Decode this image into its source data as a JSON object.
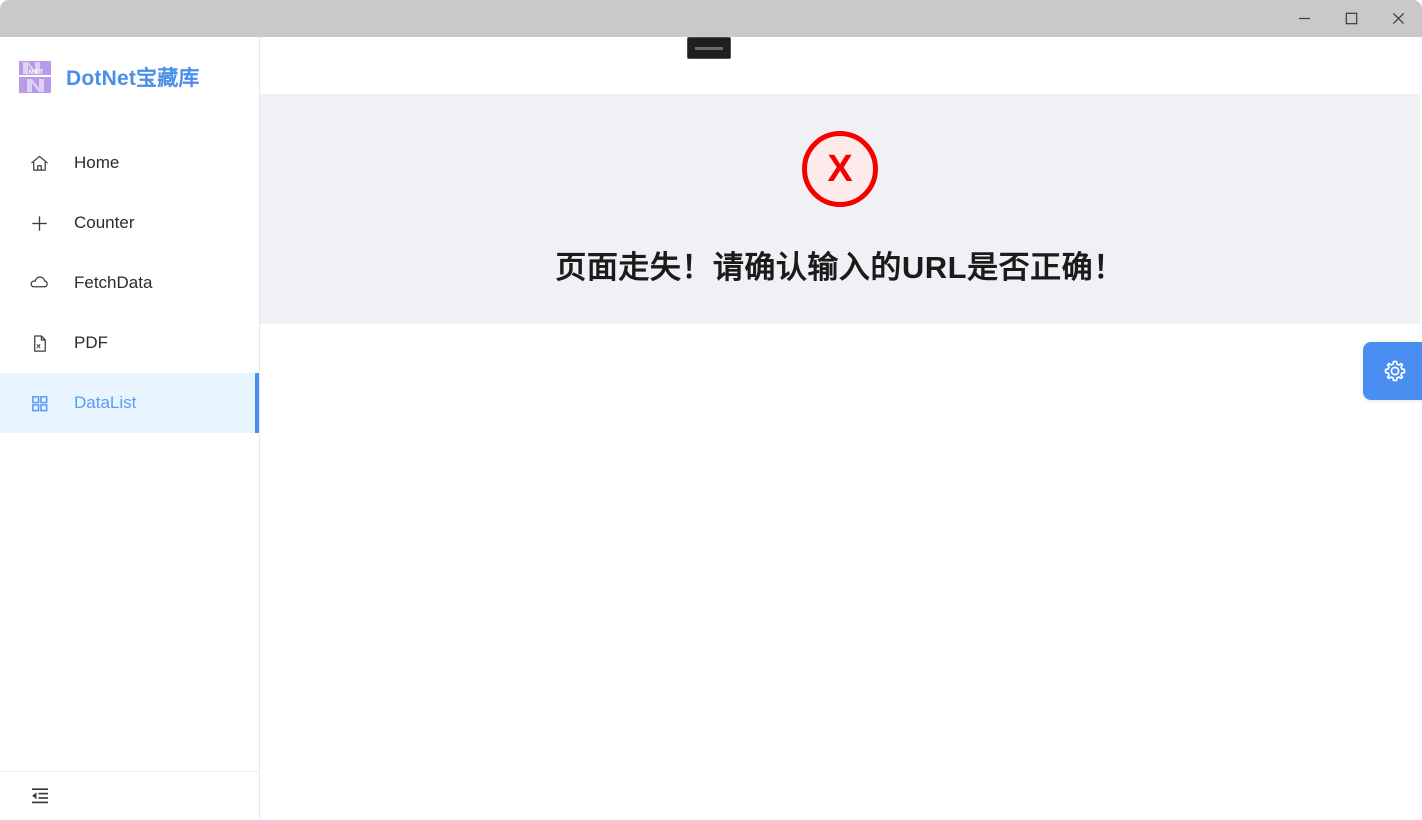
{
  "window": {
    "controls": [
      {
        "name": "minimize",
        "glyph": "minimize-icon",
        "label": "Minimize"
      },
      {
        "name": "maximize",
        "glyph": "maximize-icon",
        "label": "Maximize"
      },
      {
        "name": "close",
        "glyph": "close-icon",
        "label": "Close"
      }
    ],
    "titlebar_color": "#c9c9c9"
  },
  "sidebar": {
    "brand": {
      "title": "DotNet宝藏库",
      "logo_icon": "dotnet-logo-icon",
      "logo_text": ".NET",
      "title_color": "#4a90e8"
    },
    "items": [
      {
        "label": "Home",
        "icon": "home-icon",
        "active": false
      },
      {
        "label": "Counter",
        "icon": "plus-icon",
        "active": false
      },
      {
        "label": "FetchData",
        "icon": "cloud-icon",
        "active": false
      },
      {
        "label": "PDF",
        "icon": "document-icon",
        "active": false
      },
      {
        "label": "DataList",
        "icon": "grid-icon",
        "active": true
      }
    ],
    "active_color": "#5a9cf8",
    "active_background": "#e8f4fe",
    "footer": {
      "collapse_icon": "collapse-sidebar-icon",
      "collapse_label": "Collapse menu"
    }
  },
  "main": {
    "toast": {
      "icon": "toast-pill-icon",
      "text": ""
    },
    "error": {
      "icon": "error-circle-x-icon",
      "icon_glyph": "X",
      "message": "页面走失！请确认输入的URL是否正确！",
      "panel_background": "#f0f1f4",
      "icon_color": "#f40000",
      "icon_fill": "#fdeaea",
      "text_color": "#1b1b1b"
    },
    "settings_button": {
      "icon": "gear-icon",
      "label": "Settings",
      "color": "#4a8ef2"
    }
  }
}
